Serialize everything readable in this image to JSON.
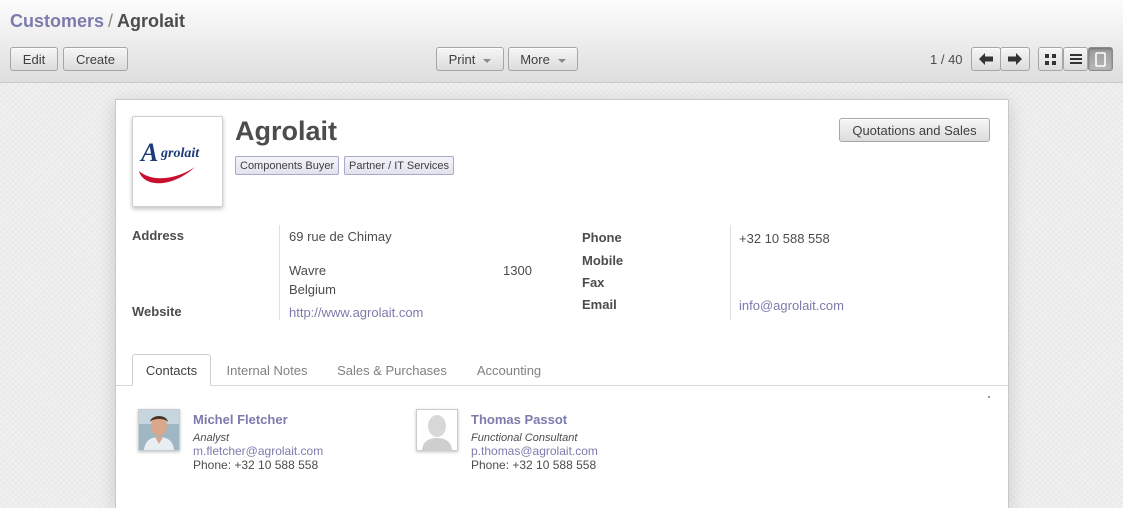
{
  "breadcrumb": {
    "parent": "Customers",
    "separator": "/",
    "current": "Agrolait"
  },
  "toolbar": {
    "edit_label": "Edit",
    "create_label": "Create",
    "print_label": "Print",
    "more_label": "More",
    "pager": "1 / 40",
    "prev_icon": "arrow-left-icon",
    "next_icon": "arrow-right-icon",
    "views": [
      "kanban-view-icon",
      "list-view-icon",
      "form-view-icon"
    ]
  },
  "partner": {
    "name": "Agrolait",
    "logo_text": "Agrolait",
    "tags": [
      "Components Buyer",
      "Partner / IT Services"
    ],
    "smart_button": "Quotations and Sales"
  },
  "fields": {
    "address_label": "Address",
    "street": "69 rue de Chimay",
    "city": "Wavre",
    "zip": "1300",
    "country": "Belgium",
    "website_label": "Website",
    "website": "http://www.agrolait.com",
    "phone_label": "Phone",
    "phone": "+32 10 588 558",
    "mobile_label": "Mobile",
    "fax_label": "Fax",
    "email_label": "Email",
    "email": "info@agrolait.com"
  },
  "tabs": [
    {
      "label": "Contacts",
      "active": true
    },
    {
      "label": "Internal Notes",
      "active": false
    },
    {
      "label": "Sales & Purchases",
      "active": false
    },
    {
      "label": "Accounting",
      "active": false
    }
  ],
  "contacts": [
    {
      "name": "Michel Fletcher",
      "function": "Analyst",
      "email": "m.fletcher@agrolait.com",
      "phone": "Phone: +32 10 588 558"
    },
    {
      "name": "Thomas Passot",
      "function": "Functional Consultant",
      "email": "p.thomas@agrolait.com",
      "phone": "Phone: +32 10 588 558"
    }
  ],
  "colors": {
    "accent": "#7c7bad",
    "text": "#4c4c4c",
    "logo_blue": "#1c3b78",
    "logo_red": "#c8102e"
  }
}
